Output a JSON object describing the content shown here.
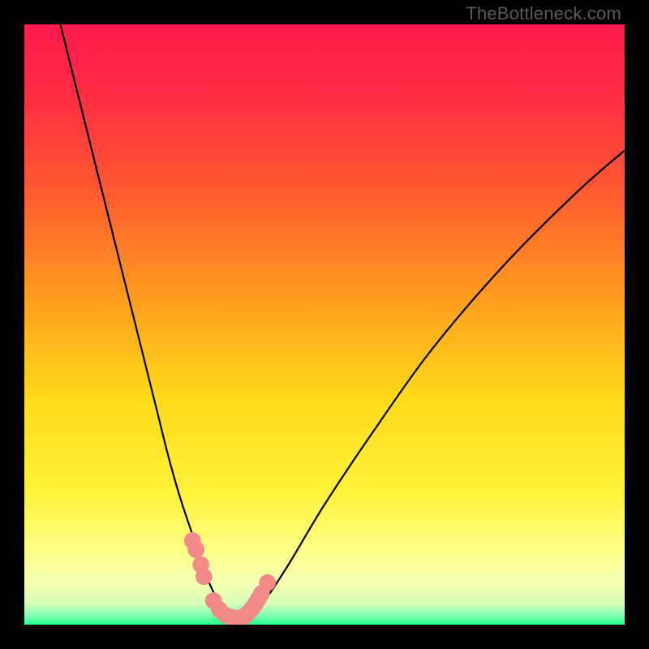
{
  "watermark": "TheBottleneck.com",
  "colors": {
    "bg": "#000000",
    "gradient_stops": [
      {
        "t": 0.0,
        "c": "#ff1a4d"
      },
      {
        "t": 0.12,
        "c": "#ff2d44"
      },
      {
        "t": 0.28,
        "c": "#ff5a30"
      },
      {
        "t": 0.45,
        "c": "#ff9a1f"
      },
      {
        "t": 0.62,
        "c": "#ffd91a"
      },
      {
        "t": 0.78,
        "c": "#fff23a"
      },
      {
        "t": 0.88,
        "c": "#fdff8a"
      },
      {
        "t": 0.93,
        "c": "#f4ffb0"
      },
      {
        "t": 0.965,
        "c": "#d6ffb8"
      },
      {
        "t": 0.985,
        "c": "#7dffb0"
      },
      {
        "t": 1.0,
        "c": "#22ff88"
      }
    ],
    "curve": "#000000",
    "markers": "#f28a8a"
  },
  "chart_data": {
    "type": "line",
    "title": "",
    "xlabel": "",
    "ylabel": "",
    "xlim": [
      0,
      100
    ],
    "ylim": [
      0,
      100
    ],
    "series": [
      {
        "name": "bottleneck-curve",
        "x": [
          6,
          10,
          14,
          18,
          22,
          24,
          26,
          28,
          30,
          31,
          32,
          33,
          34,
          35,
          36,
          37,
          38,
          40,
          44,
          50,
          58,
          68,
          80,
          92,
          100
        ],
        "y": [
          100,
          84,
          68,
          52,
          36,
          28,
          21,
          15,
          9,
          6.5,
          4.5,
          3,
          2,
          1.2,
          1,
          1.2,
          2,
          4,
          10,
          20,
          32,
          46,
          60,
          72,
          79
        ]
      }
    ],
    "markers": [
      {
        "x": 28.0,
        "y": 14.0,
        "r": 1.4
      },
      {
        "x": 28.6,
        "y": 12.5,
        "r": 1.4
      },
      {
        "x": 29.4,
        "y": 10.0,
        "r": 1.4
      },
      {
        "x": 29.9,
        "y": 8.0,
        "r": 1.4
      },
      {
        "x": 31.5,
        "y": 4.0,
        "r": 1.4
      },
      {
        "x": 32.5,
        "y": 2.5,
        "r": 1.4
      },
      {
        "x": 33.5,
        "y": 1.6,
        "r": 1.4
      },
      {
        "x": 34.5,
        "y": 1.2,
        "r": 1.4
      },
      {
        "x": 35.5,
        "y": 1.1,
        "r": 1.4
      },
      {
        "x": 36.5,
        "y": 1.3,
        "r": 1.4
      },
      {
        "x": 37.0,
        "y": 1.7,
        "r": 1.4
      },
      {
        "x": 37.5,
        "y": 2.2,
        "r": 1.4
      },
      {
        "x": 38.0,
        "y": 2.8,
        "r": 1.4
      },
      {
        "x": 38.5,
        "y": 3.5,
        "r": 1.4
      },
      {
        "x": 39.0,
        "y": 4.3,
        "r": 1.4
      },
      {
        "x": 39.5,
        "y": 5.2,
        "r": 1.4
      },
      {
        "x": 40.5,
        "y": 7.0,
        "r": 1.4
      }
    ]
  }
}
